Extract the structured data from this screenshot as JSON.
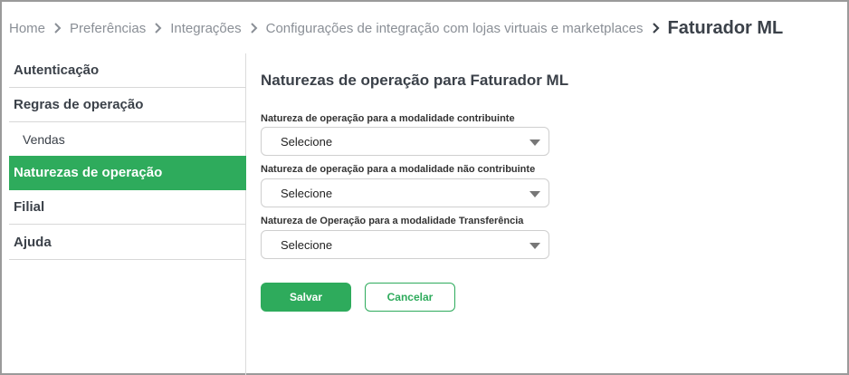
{
  "breadcrumb": {
    "items": [
      "Home",
      "Preferências",
      "Integrações",
      "Configurações de integração com lojas virtuais e marketplaces"
    ],
    "current": "Faturador ML"
  },
  "sidebar": {
    "items": [
      {
        "label": "Autenticação"
      },
      {
        "label": "Regras de operação"
      },
      {
        "label": "Vendas"
      },
      {
        "label": "Naturezas de operação"
      },
      {
        "label": "Filial"
      },
      {
        "label": "Ajuda"
      }
    ]
  },
  "main": {
    "title": "Naturezas de operação para Faturador ML",
    "fields": [
      {
        "label": "Natureza de operação para a modalidade contribuinte",
        "value": "Selecione"
      },
      {
        "label": "Natureza de operação para a modalidade não contribuinte",
        "value": "Selecione"
      },
      {
        "label": "Natureza de Operação para a modalidade Transferência",
        "value": "Selecione"
      }
    ],
    "save_label": "Salvar",
    "cancel_label": "Cancelar"
  },
  "colors": {
    "accent": "#2eab5c",
    "text_dark": "#3b4149",
    "breadcrumb_text": "#8a8f96"
  }
}
